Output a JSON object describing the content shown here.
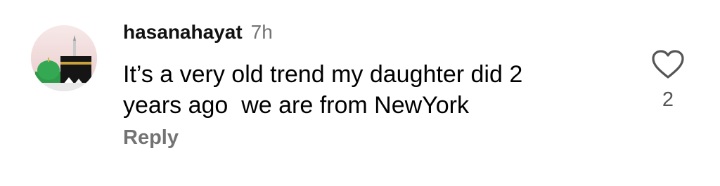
{
  "comment": {
    "username": "hasanahayat",
    "timestamp": "7h",
    "text_lines": [
      "It’s a very old trend my daughter did 2",
      "years ago  we are from NewYork"
    ],
    "reply_label": "Reply",
    "like_count": "2",
    "avatar": "user-avatar",
    "like_icon": "heart-outline-icon"
  }
}
